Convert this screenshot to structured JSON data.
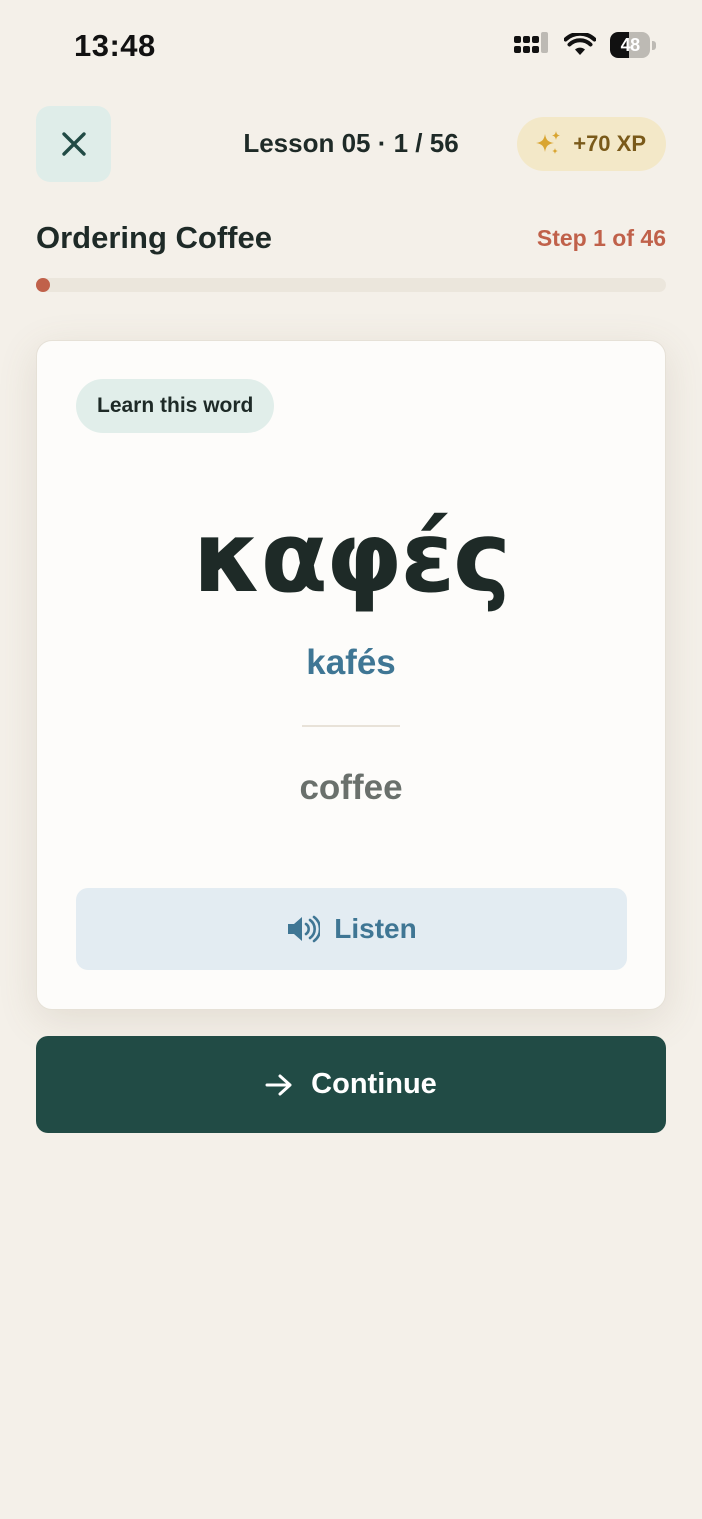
{
  "status_bar": {
    "time": "13:48",
    "battery_percent": "48",
    "battery_level": 0.48,
    "icons": [
      "cellular-signal-icon",
      "wifi-icon",
      "battery-icon"
    ]
  },
  "header": {
    "close_icon": "close-icon",
    "lesson_counter": "Lesson 05 · 1 / 56",
    "xp_icon": "sparkles-icon",
    "xp_label": "+70 XP"
  },
  "lesson": {
    "title": "Ordering Coffee",
    "step_label": "Step 1 of 46",
    "progress_fraction": 0.0217
  },
  "card": {
    "tag": "Learn this word",
    "word": "καφές",
    "transliteration": "kafés",
    "translation": "coffee",
    "listen_icon": "speaker-icon",
    "listen_label": "Listen"
  },
  "actions": {
    "continue_icon": "arrow-right-icon",
    "continue_label": "Continue"
  },
  "colors": {
    "background": "#F4F0E9",
    "accent_dark_green": "#214B45",
    "accent_terracotta": "#C0614A",
    "accent_blue": "#3F7694",
    "xp_gold": "#7A5A1A"
  }
}
